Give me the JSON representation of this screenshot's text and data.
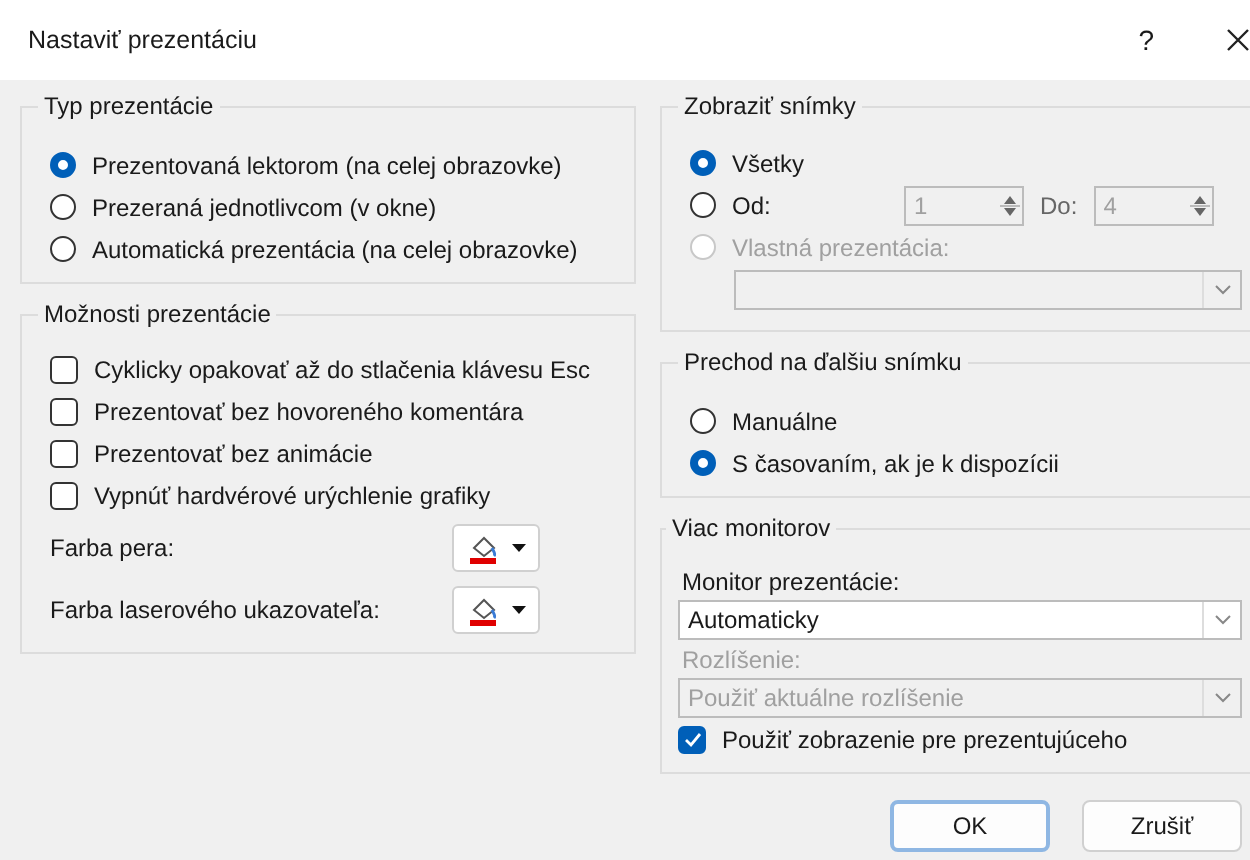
{
  "window": {
    "title": "Nastaviť prezentáciu",
    "help": "?"
  },
  "presentation_type": {
    "title": "Typ prezentácie",
    "options": [
      {
        "label": "Prezentovaná lektorom (na celej obrazovke)",
        "selected": true
      },
      {
        "label": "Prezeraná jednotlivcom (v okne)",
        "selected": false
      },
      {
        "label": "Automatická prezentácia (na celej obrazovke)",
        "selected": false
      }
    ]
  },
  "presentation_options": {
    "title": "Možnosti prezentácie",
    "checkboxes": [
      {
        "label": "Cyklicky opakovať až do stlačenia klávesu Esc",
        "checked": false
      },
      {
        "label": "Prezentovať bez hovoreného komentára",
        "checked": false
      },
      {
        "label": "Prezentovať bez animácie",
        "checked": false
      },
      {
        "label": "Vypnúť hardvérové urýchlenie grafiky",
        "checked": false
      }
    ],
    "colors": [
      {
        "label": "Farba pera:"
      },
      {
        "label": "Farba laserového ukazovateľa:"
      }
    ]
  },
  "show_slides": {
    "title": "Zobraziť snímky",
    "options": [
      {
        "kind": "plain",
        "label": "Všetky",
        "selected": true,
        "disabled": false
      },
      {
        "kind": "range",
        "label": "Od:",
        "selected": false,
        "disabled": false,
        "from": "1",
        "to_label": "Do:",
        "to": "4"
      },
      {
        "kind": "custom",
        "label": "Vlastná prezentácia:",
        "selected": false,
        "disabled": true
      }
    ]
  },
  "advance": {
    "title": "Prechod na ďalšiu snímku",
    "options": [
      {
        "label": "Manuálne",
        "selected": false
      },
      {
        "label": "S časovaním, ak je k dispozícii",
        "selected": true
      }
    ]
  },
  "monitors": {
    "title": "Viac monitorov",
    "monitor_label": "Monitor prezentácie:",
    "monitor_value": "Automaticky",
    "resolution_label": "Rozlíšenie:",
    "resolution_value": "Použiť aktuálne rozlíšenie",
    "resolution_disabled": true,
    "presenter_view": {
      "label": "Použiť zobrazenie pre prezentujúceho",
      "checked": true
    }
  },
  "buttons": [
    {
      "label": "OK",
      "default": true
    },
    {
      "label": "Zrušiť",
      "default": false
    }
  ]
}
